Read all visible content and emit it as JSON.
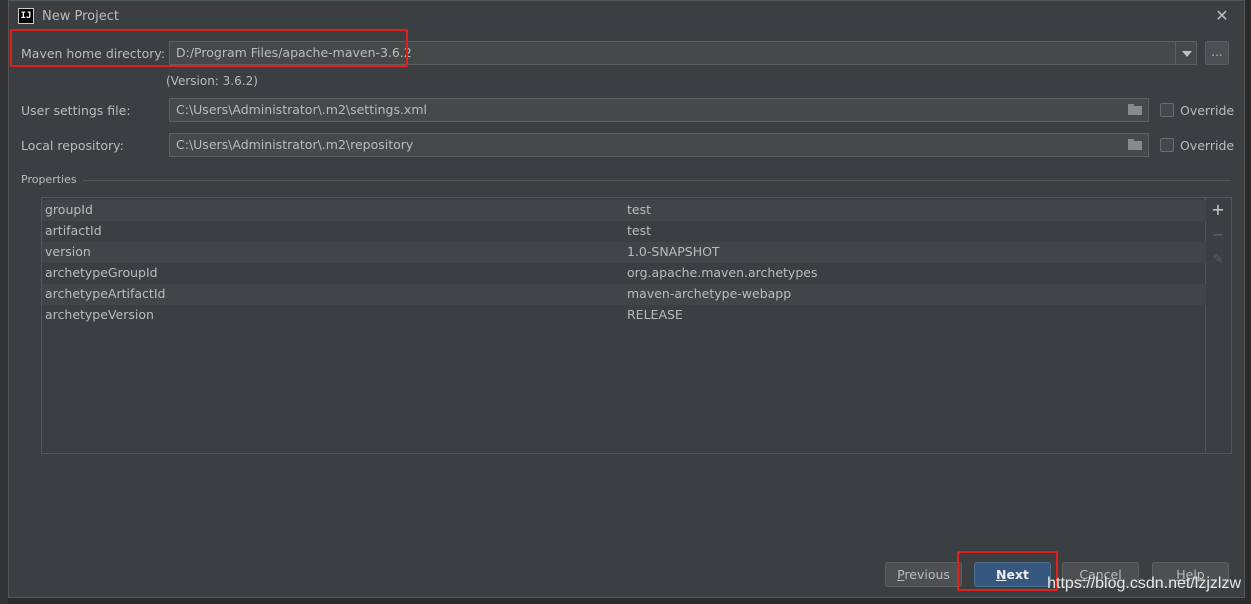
{
  "window": {
    "title": "New Project",
    "icon_text": "IJ",
    "close_label": "✕"
  },
  "maven_home": {
    "label": "Maven home directory:",
    "value": "D:/Program Files/apache-maven-3.6.2",
    "version_note": "(Version: 3.6.2)",
    "browse_label": "..."
  },
  "user_settings": {
    "label": "User settings file:",
    "value": "C:\\Users\\Administrator\\.m2\\settings.xml",
    "override_label": "Override",
    "override_checked": false
  },
  "local_repo": {
    "label": "Local repository:",
    "value": "C:\\Users\\Administrator\\.m2\\repository",
    "override_label": "Override",
    "override_checked": false
  },
  "properties": {
    "title": "Properties",
    "rows": [
      {
        "key": "groupId",
        "value": "test"
      },
      {
        "key": "artifactId",
        "value": "test"
      },
      {
        "key": "version",
        "value": "1.0-SNAPSHOT"
      },
      {
        "key": "archetypeGroupId",
        "value": "org.apache.maven.archetypes"
      },
      {
        "key": "archetypeArtifactId",
        "value": "maven-archetype-webapp"
      },
      {
        "key": "archetypeVersion",
        "value": "RELEASE"
      }
    ],
    "toolbar": {
      "add": "+",
      "remove": "−",
      "edit": "✎"
    }
  },
  "buttons": {
    "previous": "Previous",
    "next": "Next",
    "cancel": "Cancel",
    "help": "Help"
  },
  "watermark": "https://blog.csdn.net/lzjzlzw",
  "colors": {
    "background": "#3c3f41",
    "field": "#45494a",
    "primary_button": "#365880",
    "highlight": "#e01f1f"
  }
}
